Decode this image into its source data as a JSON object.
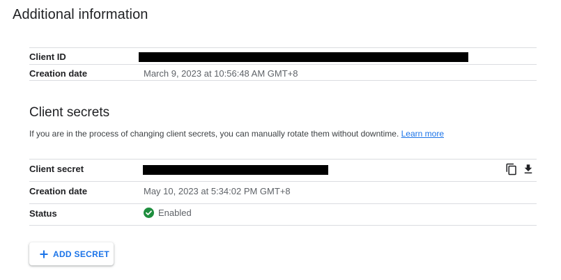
{
  "section": {
    "title": "Additional information"
  },
  "client_info": {
    "client_id_label": "Client ID",
    "creation_date_label": "Creation date",
    "creation_date_value": "March 9, 2023 at 10:56:48 AM GMT+8"
  },
  "client_secrets": {
    "heading": "Client secrets",
    "helper_text": "If you are in the process of changing client secrets, you can manually rotate them without downtime. ",
    "learn_more": "Learn more",
    "secret_label": "Client secret",
    "creation_date_label": "Creation date",
    "creation_date_value": "May 10, 2023 at 5:34:02 PM GMT+8",
    "status_label": "Status",
    "status_value": "Enabled",
    "copy_icon": "copy-icon",
    "download_icon": "download-icon"
  },
  "actions": {
    "add_secret_label": "ADD SECRET",
    "add_icon": "plus-icon"
  },
  "colors": {
    "accent": "#1a73e8",
    "enabled": "#1e8e3e",
    "divider": "#dadce0"
  }
}
